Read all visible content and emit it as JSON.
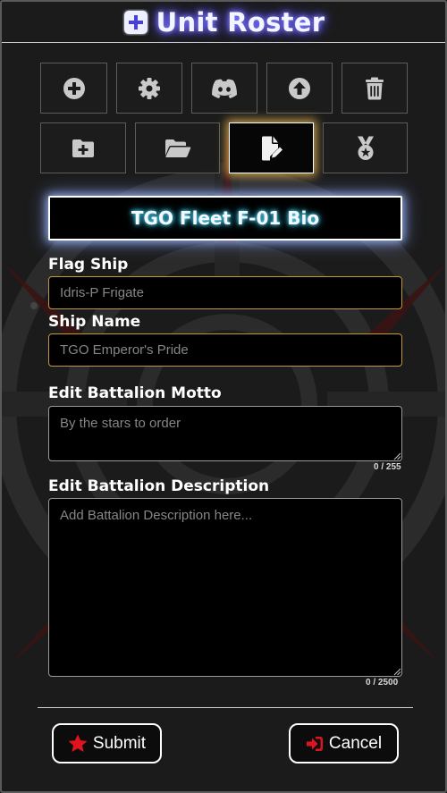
{
  "header": {
    "title": "Unit Roster",
    "icon": "file-plus-icon"
  },
  "toolbar": {
    "row1": [
      {
        "name": "add-unit-button",
        "icon": "plus-circle-icon"
      },
      {
        "name": "settings-button",
        "icon": "gear-icon"
      },
      {
        "name": "discord-button",
        "icon": "discord-icon"
      },
      {
        "name": "upload-button",
        "icon": "arrow-up-circle-icon"
      },
      {
        "name": "delete-button",
        "icon": "trash-icon"
      }
    ],
    "row2": [
      {
        "name": "new-folder-button",
        "icon": "folder-plus-icon"
      },
      {
        "name": "open-folder-button",
        "icon": "folder-open-icon"
      },
      {
        "name": "edit-bio-button",
        "icon": "file-pen-icon",
        "active": true
      },
      {
        "name": "medal-button",
        "icon": "medal-icon"
      }
    ]
  },
  "bio_title": "TGO Fleet F-01 Bio",
  "form": {
    "flag_ship": {
      "label": "Flag Ship",
      "value": "",
      "placeholder": "Idris-P Frigate"
    },
    "ship_name": {
      "label": "Ship Name",
      "value": "",
      "placeholder": "TGO Emperor's Pride"
    },
    "motto": {
      "label": "Edit Battalion Motto",
      "value": "",
      "placeholder": "By the stars to order",
      "counter": "0 / 255"
    },
    "description": {
      "label": "Edit Battalion Description",
      "value": "",
      "placeholder": "Add Battalion Description here...",
      "counter": "0 / 2500"
    }
  },
  "actions": {
    "submit": {
      "label": "Submit",
      "icon": "star-icon"
    },
    "cancel": {
      "label": "Cancel",
      "icon": "sign-in-icon"
    }
  },
  "colors": {
    "accent_gold": "#c49b3b",
    "title_glow": "#6b62ff",
    "bio_glow": "#2ad0ff",
    "icon_red": "#e0141e",
    "emblem_red": "#7a1a1a"
  }
}
